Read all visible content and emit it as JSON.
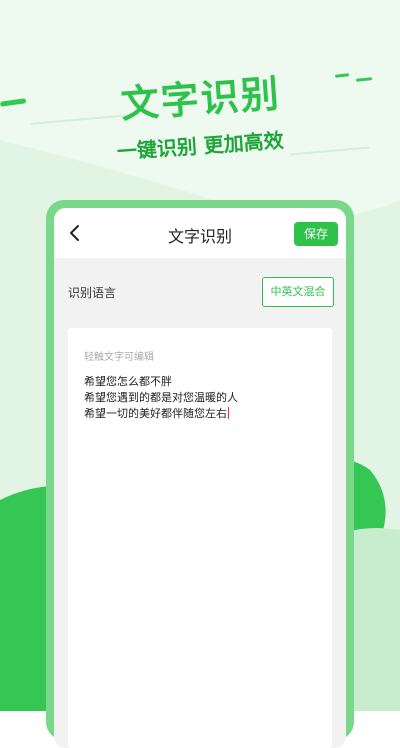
{
  "hero": {
    "title": "文字识别",
    "subtitle": "一键识别 更加高效"
  },
  "screen": {
    "nav": {
      "back_icon": "chevron-left-icon",
      "title": "文字识别",
      "save_label": "保存"
    },
    "language": {
      "label": "识别语言",
      "selected": "中英文混合"
    },
    "editor": {
      "placeholder": "轻触文字可编辑",
      "lines": [
        "希望您怎么都不胖",
        "希望您遇到的都是对您温暖的人",
        "希望一切的美好都伴随您左右"
      ]
    }
  },
  "colors": {
    "accent": "#2fc24b",
    "accent_dark": "#1fa53a",
    "bg_light": "#e3f5e6",
    "bg_mid": "#c9edd0",
    "blob": "#36c653"
  }
}
